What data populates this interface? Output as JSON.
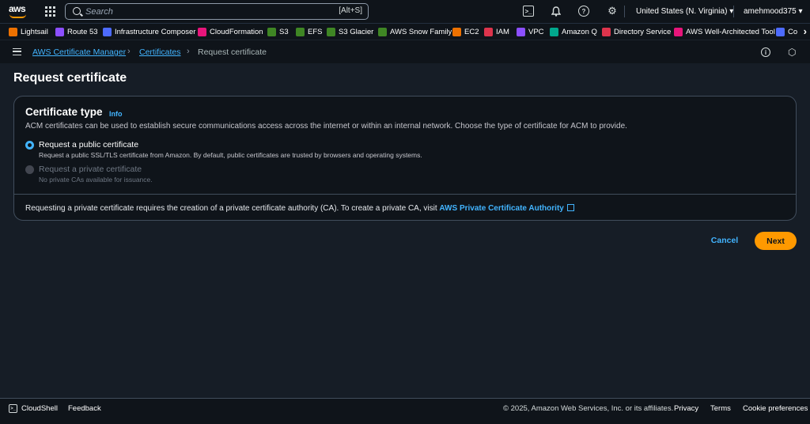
{
  "topnav": {
    "search_placeholder": "Search",
    "search_shortcut": "[Alt+S]",
    "region": "United States (N. Virginia) ▾",
    "user": "amehmood375 ▾"
  },
  "favorites": [
    {
      "label": "Lightsail",
      "icon": "lightsail-icon",
      "color": "#ed7100"
    },
    {
      "label": "Route 53",
      "icon": "route53-icon",
      "color": "#8c4fff"
    },
    {
      "label": "Infrastructure Composer",
      "icon": "composer-icon",
      "color": "#4d6bfe"
    },
    {
      "label": "CloudFormation",
      "icon": "cloudformation-icon",
      "color": "#e7157b"
    },
    {
      "label": "S3",
      "icon": "s3-icon",
      "color": "#3f8624"
    },
    {
      "label": "EFS",
      "icon": "efs-icon",
      "color": "#3f8624"
    },
    {
      "label": "S3 Glacier",
      "icon": "glacier-icon",
      "color": "#3f8624"
    },
    {
      "label": "AWS Snow Family",
      "icon": "snow-icon",
      "color": "#3f8624"
    },
    {
      "label": "EC2",
      "icon": "ec2-icon",
      "color": "#ed7100"
    },
    {
      "label": "IAM",
      "icon": "iam-icon",
      "color": "#dd344c"
    },
    {
      "label": "VPC",
      "icon": "vpc-icon",
      "color": "#8c4fff"
    },
    {
      "label": "Amazon Q",
      "icon": "amazon-q-icon",
      "color": "#01a88d"
    },
    {
      "label": "Directory Service",
      "icon": "directory-icon",
      "color": "#dd344c"
    },
    {
      "label": "AWS Well-Architected Tool",
      "icon": "well-architected-icon",
      "color": "#e7157b"
    },
    {
      "label": "Co",
      "icon": "co-icon",
      "color": "#4d6bfe"
    }
  ],
  "breadcrumb": {
    "service": "AWS Certificate Manager",
    "section": "Certificates",
    "current": "Request certificate"
  },
  "page": {
    "title": "Request certificate"
  },
  "panel": {
    "title": "Certificate type",
    "info": "Info",
    "description": "ACM certificates can be used to establish secure communications access across the internet or within an internal network. Choose the type of certificate for ACM to provide.",
    "options": [
      {
        "label": "Request a public certificate",
        "desc": "Request a public SSL/TLS certificate from Amazon. By default, public certificates are trusted by browsers and operating systems.",
        "selected": true,
        "disabled": false
      },
      {
        "label": "Request a private certificate",
        "desc": "No private CAs available for issuance.",
        "selected": false,
        "disabled": true
      }
    ],
    "footer_text": "Requesting a private certificate requires the creation of a private certificate authority (CA). To create a private CA, visit ",
    "footer_link": "AWS Private Certificate Authority"
  },
  "actions": {
    "cancel": "Cancel",
    "next": "Next"
  },
  "footer": {
    "cloudshell": "CloudShell",
    "feedback": "Feedback",
    "copyright": "© 2025, Amazon Web Services, Inc. or its affiliates.",
    "privacy": "Privacy",
    "terms": "Terms",
    "cookies": "Cookie preferences"
  },
  "colors": {
    "accent": "#42b4ff",
    "primary_button": "#ff9900",
    "background": "#161d26",
    "panel": "#0f141a"
  }
}
